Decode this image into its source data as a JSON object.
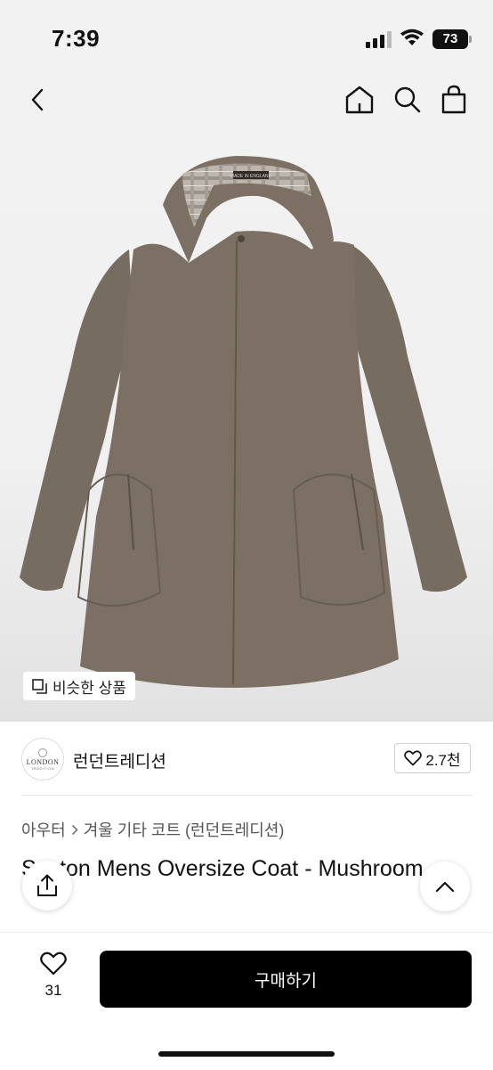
{
  "status_bar": {
    "time": "7:39",
    "battery": "73"
  },
  "nav": {
    "back_icon": "chevron-left-icon",
    "home_icon": "home-icon",
    "search_icon": "search-icon",
    "bag_icon": "shopping-bag-icon"
  },
  "hero": {
    "similar_label": "비슷한 상품",
    "coat_label": "MADE IN ENGLAND"
  },
  "brand": {
    "logo_line1": "LONDON",
    "logo_line2": "TRADITION",
    "name": "런던트레디션",
    "likes": "2.7천"
  },
  "breadcrumb": {
    "category": "아우터",
    "subcategory": "겨울 기타 코트 (런던트레디션)"
  },
  "product": {
    "title": "Saxton Mens Oversize Coat - Mushroom"
  },
  "bottom": {
    "wish_count": "31",
    "buy_label": "구매하기"
  },
  "colors": {
    "coat": "#7b7063",
    "buy_button": "#000000"
  }
}
